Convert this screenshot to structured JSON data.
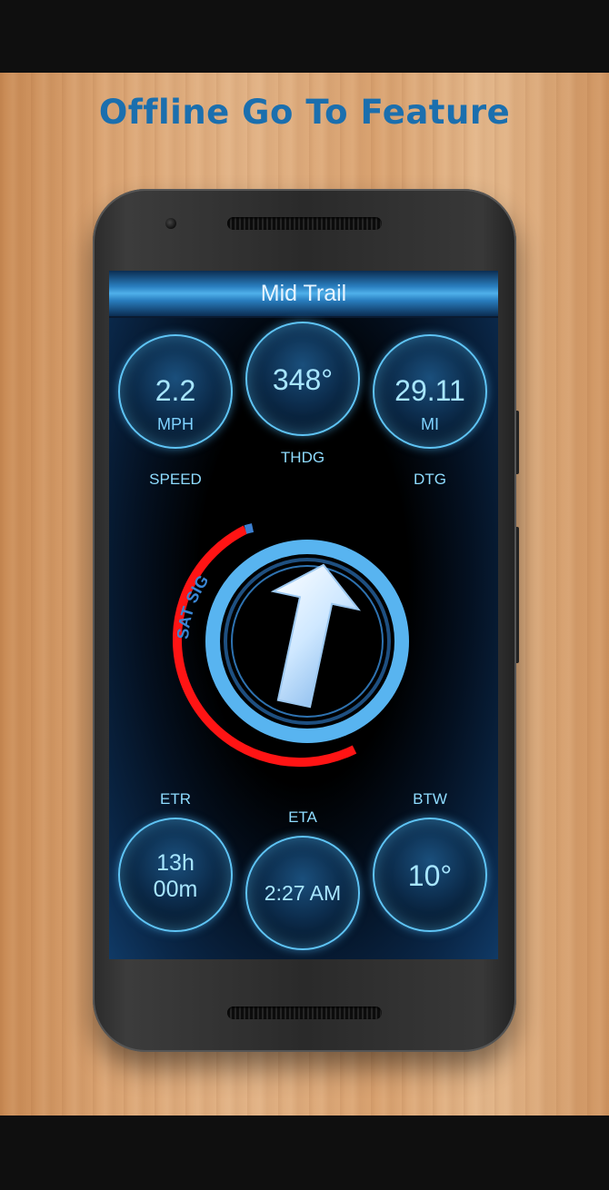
{
  "headline": "Offline Go To Feature",
  "app": {
    "title": "Mid Trail",
    "top_gauges": {
      "speed": {
        "value": "2.2",
        "unit": "MPH",
        "label": "SPEED"
      },
      "thdg": {
        "value": "348°",
        "label": "THDG"
      },
      "dtg": {
        "value": "29.11",
        "unit": "MI",
        "label": "DTG"
      }
    },
    "compass": {
      "sat_sig_label": "SAT SIG",
      "heading_degrees": 348
    },
    "bottom_gauges": {
      "etr": {
        "value_line1": "13h",
        "value_line2": "00m",
        "label": "ETR"
      },
      "eta": {
        "value": "2:27 AM",
        "label": "ETA"
      },
      "btw": {
        "value": "10°",
        "label": "BTW"
      }
    }
  },
  "colors": {
    "accent": "#4fb0ea",
    "ring_blue": "#58b4f0",
    "sat_red": "#ff1414",
    "headline_blue": "#1b6fae"
  }
}
